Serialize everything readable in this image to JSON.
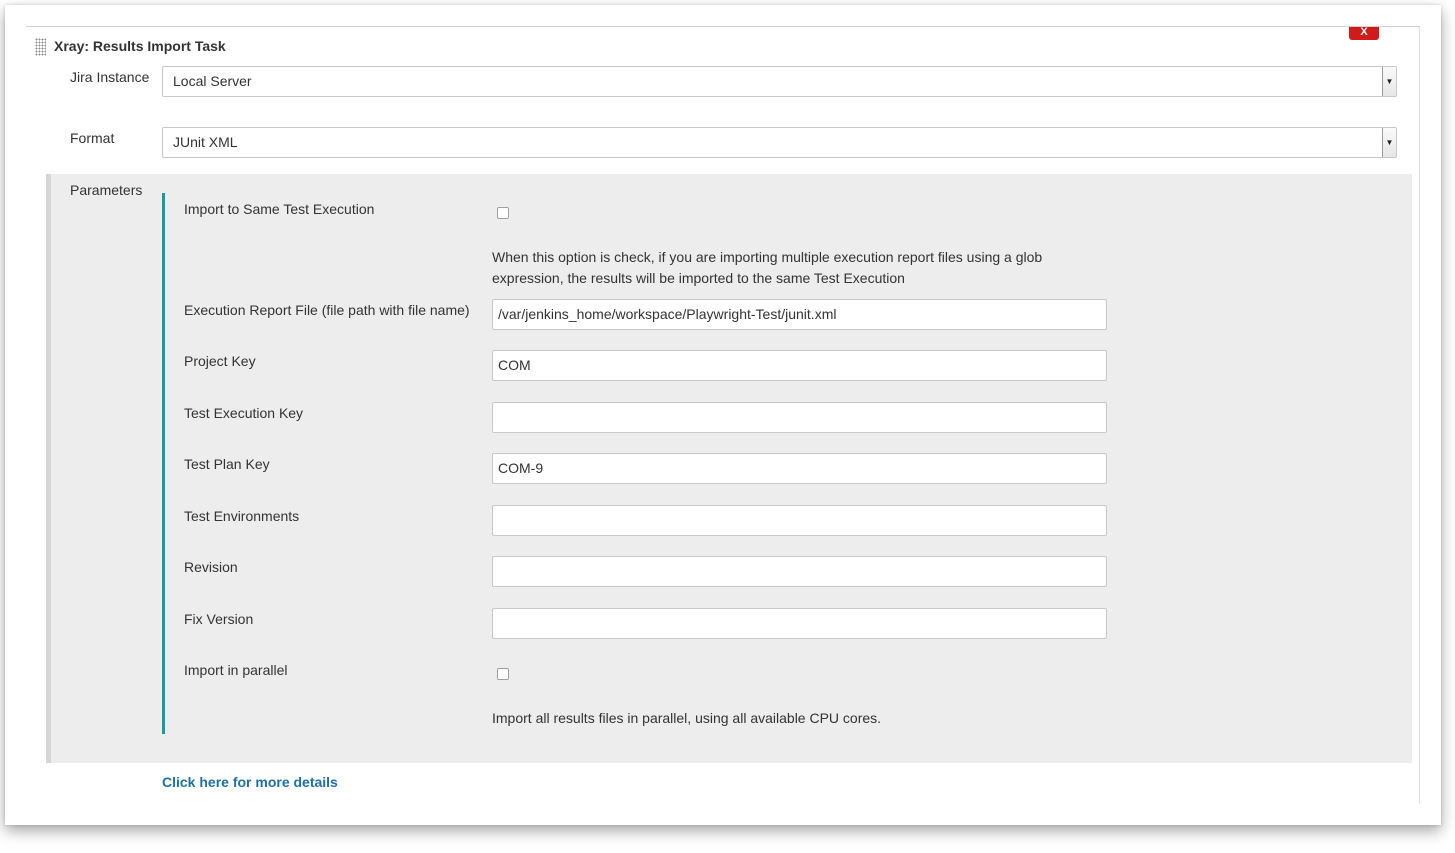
{
  "task": {
    "title": "Xray: Results Import Task",
    "close_label": "X"
  },
  "jira_instance": {
    "label": "Jira Instance",
    "value": "Local Server"
  },
  "format": {
    "label": "Format",
    "value": "JUnit XML"
  },
  "parameters": {
    "label": "Parameters",
    "import_same_execution": {
      "label": "Import to Same Test Execution",
      "checked": false,
      "help_line1": "When this option is check, if you are importing multiple execution report files using a glob",
      "help_line2": "expression, the results will be imported to the same Test Execution"
    },
    "fields": [
      {
        "label": "Execution Report File (file path with file name)",
        "value": "/var/jenkins_home/workspace/Playwright-Test/junit.xml"
      },
      {
        "label": "Project Key",
        "value": "COM"
      },
      {
        "label": "Test Execution Key",
        "value": ""
      },
      {
        "label": "Test Plan Key",
        "value": "COM-9"
      },
      {
        "label": "Test Environments",
        "value": ""
      },
      {
        "label": "Revision",
        "value": ""
      },
      {
        "label": "Fix Version",
        "value": ""
      }
    ],
    "import_parallel": {
      "label": "Import in parallel",
      "checked": false,
      "help": "Import all results files in parallel, using all available CPU cores."
    }
  },
  "more_details_link": "Click here for more details",
  "colors": {
    "accent_bar": "#1c9aa2",
    "link": "#1f6fa8",
    "close_button": "#d11b1b",
    "params_background": "#ededed"
  }
}
